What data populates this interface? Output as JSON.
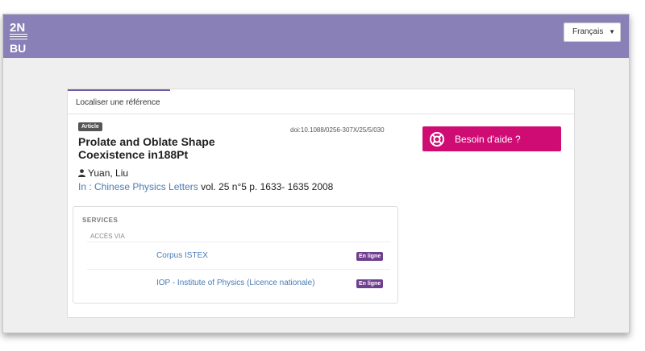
{
  "header": {
    "logo_top": "2N",
    "logo_small": "UNIVERSITÉ RENNES 2",
    "logo_bottom": "BU",
    "language": "Français"
  },
  "tab": {
    "label": "Localiser une référence"
  },
  "reference": {
    "badge": "Article",
    "doi": "doi:10.1088/0256-307X/25/5/030",
    "title": "Prolate and Oblate Shape Coexistence in188Pt",
    "author": "Yuan, Liu",
    "source_prefix": "In : ",
    "journal": "Chinese Physics Letters",
    "details": " vol. 25 n°5 p. 1633- 1635 2008"
  },
  "help": {
    "label": "Besoin d'aide ?"
  },
  "services": {
    "title": "SERVICES",
    "access_label": "ACCÈS VIA",
    "items": [
      {
        "name": "Corpus ISTEX",
        "status": "En ligne"
      },
      {
        "name": "IOP - Institute of Physics (Licence nationale)",
        "status": "En ligne"
      }
    ]
  }
}
